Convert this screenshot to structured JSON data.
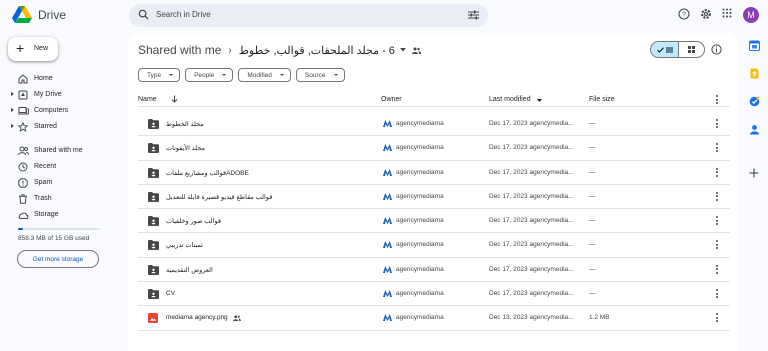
{
  "app": {
    "name": "Drive"
  },
  "search": {
    "placeholder": "Search in Drive"
  },
  "account": {
    "avatar_letter": "M",
    "avatar_color": "#8e3cb3"
  },
  "new_button": {
    "label": "New"
  },
  "nav": {
    "items": [
      {
        "label": "Home",
        "icon": "home-icon"
      },
      {
        "label": "My Drive",
        "icon": "drive-icon",
        "expandable": true
      },
      {
        "label": "Computers",
        "icon": "computer-icon",
        "expandable": true
      },
      {
        "label": "Starred",
        "icon": "star-icon",
        "expandable": true
      },
      {
        "label": "Shared with me",
        "icon": "people-icon"
      },
      {
        "label": "Recent",
        "icon": "clock-icon"
      },
      {
        "label": "Spam",
        "icon": "spam-icon"
      },
      {
        "label": "Trash",
        "icon": "trash-icon"
      },
      {
        "label": "Storage",
        "icon": "cloud-icon"
      }
    ],
    "storage_used_text": "858.3 MB of 15 GB used",
    "storage_fraction": 0.057,
    "get_storage_label": "Get more storage"
  },
  "breadcrumb": {
    "root": "Shared with me",
    "folder": "6 - مجلد الملحقات, قوالب, خطوط"
  },
  "filters": [
    "Type",
    "People",
    "Modified",
    "Source"
  ],
  "table": {
    "headers": {
      "name": "Name",
      "owner": "Owner",
      "modified": "Last modified",
      "size": "File size"
    },
    "rows": [
      {
        "name": "مجلد الخطوط",
        "type": "folder",
        "owner": "agencymediama",
        "modified": "Dec 17, 2023 agencymedia...",
        "size": "—"
      },
      {
        "name": "مجلد الأيقونات",
        "type": "folder",
        "owner": "agencymediama",
        "modified": "Dec 17, 2023 agencymedia...",
        "size": "—"
      },
      {
        "name": "قوالب ومشاريع ملفاتADOBE",
        "type": "folder",
        "owner": "agencymediama",
        "modified": "Dec 17, 2023 agencymedia...",
        "size": "—"
      },
      {
        "name": "قوالب مقاطع فيديو قصيرة قابلة للتعديل",
        "type": "folder",
        "owner": "agencymediama",
        "modified": "Dec 17, 2023 agencymedia...",
        "size": "—"
      },
      {
        "name": "قوالب صور وخلفيات",
        "type": "folder",
        "owner": "agencymediama",
        "modified": "Dec 17, 2023 agencymedia...",
        "size": "—"
      },
      {
        "name": "ثمبنات تدريبي",
        "type": "folder",
        "owner": "agencymediama",
        "modified": "Dec 17, 2023 agencymedia...",
        "size": "—"
      },
      {
        "name": "العروض التقديمية",
        "type": "folder",
        "owner": "agencymediama",
        "modified": "Dec 17, 2023 agencymedia...",
        "size": "—"
      },
      {
        "name": "CV",
        "type": "folder",
        "owner": "agencymediama",
        "modified": "Dec 17, 2023 agencymedia...",
        "size": "—"
      },
      {
        "name": "mediama agency.png",
        "type": "image",
        "shared": true,
        "owner": "agencymediama",
        "modified": "Dec 13, 2023 agencymedia...",
        "size": "1.2 MB"
      }
    ]
  },
  "colors": {
    "accent": "#0b57d0",
    "selected_view": "#c2e7ff",
    "image_file": "#ea4335"
  }
}
